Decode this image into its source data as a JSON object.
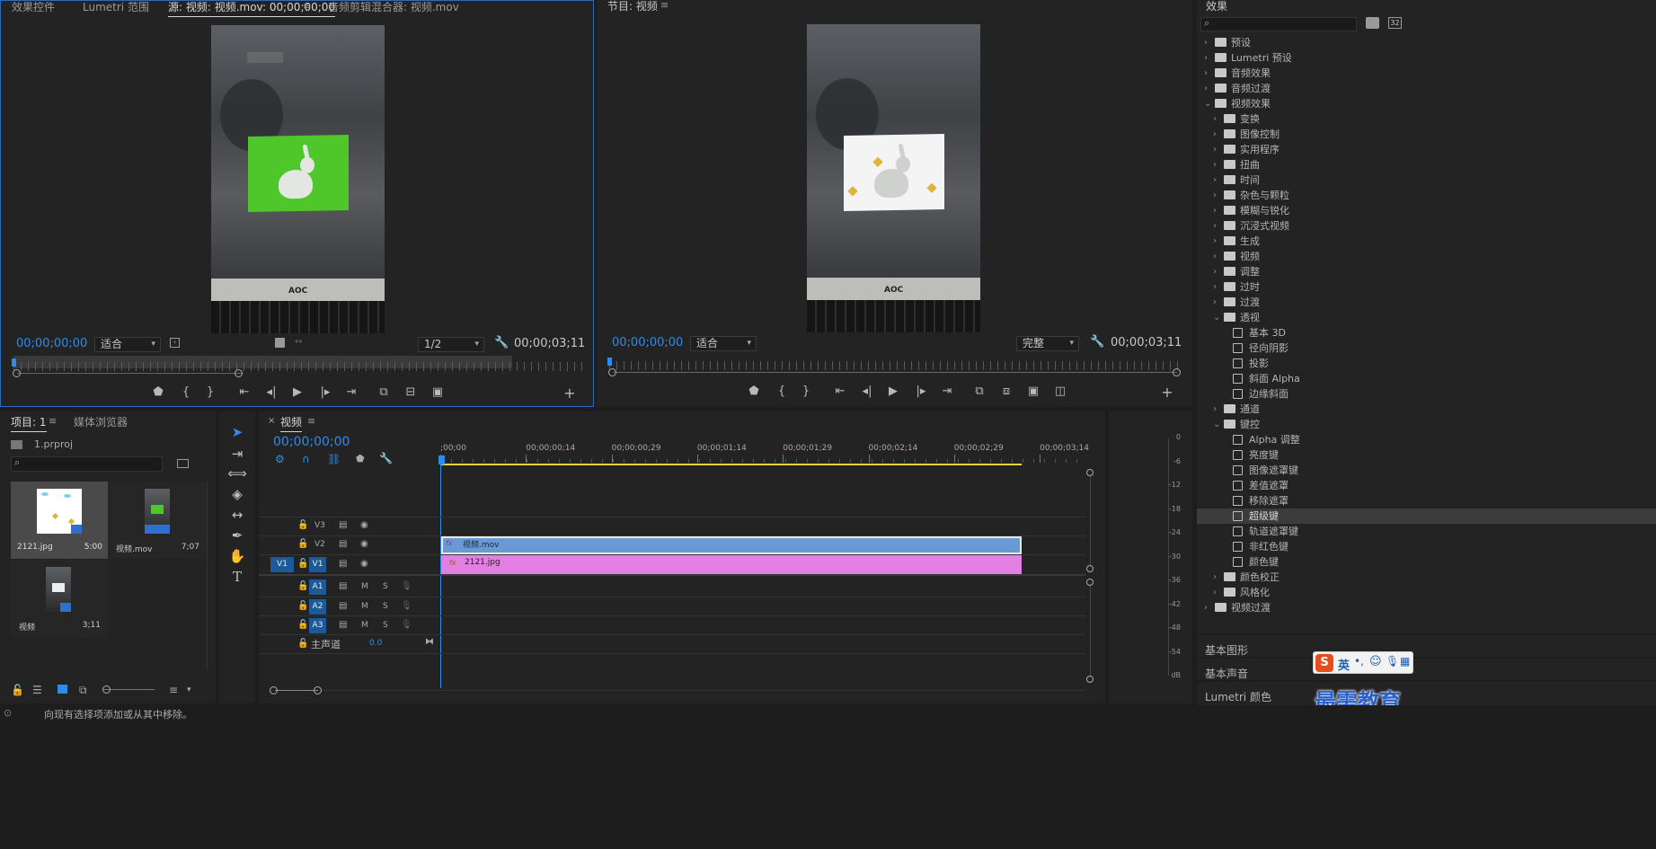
{
  "source_panel": {
    "tabs": [
      "效果控件",
      "Lumetri 范围",
      "源: 视频: 视频.mov: 00;00;00;00",
      "音频剪辑混合器: 视频.mov"
    ],
    "timecode": "00;00;00;00",
    "fit": "适合",
    "resolution": "1/2",
    "duration": "00;00;03;11"
  },
  "program_panel": {
    "title": "节目: 视频",
    "timecode": "00;00;00;00",
    "fit": "适合",
    "quality": "完整",
    "duration": "00;00;03;11"
  },
  "effects_panel": {
    "title": "效果",
    "search_placeholder": "",
    "icon_32": "32",
    "tree": [
      {
        "label": "预设",
        "level": 0,
        "type": "folder",
        "open": false
      },
      {
        "label": "Lumetri 预设",
        "level": 0,
        "type": "folder",
        "open": false
      },
      {
        "label": "音频效果",
        "level": 0,
        "type": "folder",
        "open": false
      },
      {
        "label": "音频过渡",
        "level": 0,
        "type": "folder",
        "open": false
      },
      {
        "label": "视频效果",
        "level": 0,
        "type": "folder",
        "open": true
      },
      {
        "label": "变换",
        "level": 1,
        "type": "folder",
        "open": false
      },
      {
        "label": "图像控制",
        "level": 1,
        "type": "folder",
        "open": false
      },
      {
        "label": "实用程序",
        "level": 1,
        "type": "folder",
        "open": false
      },
      {
        "label": "扭曲",
        "level": 1,
        "type": "folder",
        "open": false
      },
      {
        "label": "时间",
        "level": 1,
        "type": "folder",
        "open": false
      },
      {
        "label": "杂色与颗粒",
        "level": 1,
        "type": "folder",
        "open": false
      },
      {
        "label": "模糊与锐化",
        "level": 1,
        "type": "folder",
        "open": false
      },
      {
        "label": "沉浸式视频",
        "level": 1,
        "type": "folder",
        "open": false
      },
      {
        "label": "生成",
        "level": 1,
        "type": "folder",
        "open": false
      },
      {
        "label": "视频",
        "level": 1,
        "type": "folder",
        "open": false
      },
      {
        "label": "调整",
        "level": 1,
        "type": "folder",
        "open": false
      },
      {
        "label": "过时",
        "level": 1,
        "type": "folder",
        "open": false
      },
      {
        "label": "过渡",
        "level": 1,
        "type": "folder",
        "open": false
      },
      {
        "label": "透视",
        "level": 1,
        "type": "folder",
        "open": true
      },
      {
        "label": "基本 3D",
        "level": 2,
        "type": "preset"
      },
      {
        "label": "径向阴影",
        "level": 2,
        "type": "preset"
      },
      {
        "label": "投影",
        "level": 2,
        "type": "preset"
      },
      {
        "label": "斜面 Alpha",
        "level": 2,
        "type": "preset"
      },
      {
        "label": "边缘斜面",
        "level": 2,
        "type": "preset"
      },
      {
        "label": "通道",
        "level": 1,
        "type": "folder",
        "open": false
      },
      {
        "label": "键控",
        "level": 1,
        "type": "folder",
        "open": true
      },
      {
        "label": "Alpha 调整",
        "level": 2,
        "type": "preset"
      },
      {
        "label": "亮度键",
        "level": 2,
        "type": "preset"
      },
      {
        "label": "图像遮罩键",
        "level": 2,
        "type": "preset"
      },
      {
        "label": "差值遮罩",
        "level": 2,
        "type": "preset"
      },
      {
        "label": "移除遮罩",
        "level": 2,
        "type": "preset"
      },
      {
        "label": "超级键",
        "level": 2,
        "type": "preset",
        "selected": true
      },
      {
        "label": "轨道遮罩键",
        "level": 2,
        "type": "preset"
      },
      {
        "label": "非红色键",
        "level": 2,
        "type": "preset"
      },
      {
        "label": "颜色键",
        "level": 2,
        "type": "preset"
      },
      {
        "label": "颜色校正",
        "level": 1,
        "type": "folder",
        "open": false
      },
      {
        "label": "风格化",
        "level": 1,
        "type": "folder",
        "open": false
      },
      {
        "label": "视频过渡",
        "level": 0,
        "type": "folder",
        "open": false
      }
    ],
    "sections": [
      "基本图形",
      "基本声音",
      "Lumetri 颜色"
    ]
  },
  "ime": {
    "lang": "英"
  },
  "watermark": "最需教育",
  "project_panel": {
    "tabs": [
      "项目: 1",
      "媒体浏览器"
    ],
    "file": "1.prproj",
    "items": [
      {
        "name": "2121.jpg",
        "duration": "5:00"
      },
      {
        "name": "视频.mov",
        "duration": "7;07"
      },
      {
        "name": "视频",
        "duration": "3;11"
      }
    ]
  },
  "timeline": {
    "tab": "视频",
    "timecode": "00;00;00;00",
    "ruler": [
      ";00;00",
      "00;00;00;14",
      "00;00;00;29",
      "00;00;01;14",
      "00;00;01;29",
      "00;00;02;14",
      "00;00;02;29",
      "00;00;03;14"
    ],
    "video_tracks": [
      "V3",
      "V2",
      "V1"
    ],
    "source_patch_v": "V1",
    "audio_tracks": [
      "A1",
      "A2",
      "A3"
    ],
    "master": {
      "label": "主声道",
      "value": "0.0"
    },
    "clips": [
      {
        "name": "视频.mov",
        "track": "V2",
        "color": "#6a99d4"
      },
      {
        "name": "2121.jpg",
        "track": "V1",
        "color": "#e27fe0"
      }
    ],
    "ms": [
      "M",
      "S"
    ]
  },
  "meter": {
    "scale": [
      "0",
      "-6",
      "-12",
      "-18",
      "-24",
      "-30",
      "-36",
      "-42",
      "-48",
      "-54",
      "dB"
    ]
  },
  "status": {
    "text": "向现有选择项添加或从其中移除。"
  }
}
